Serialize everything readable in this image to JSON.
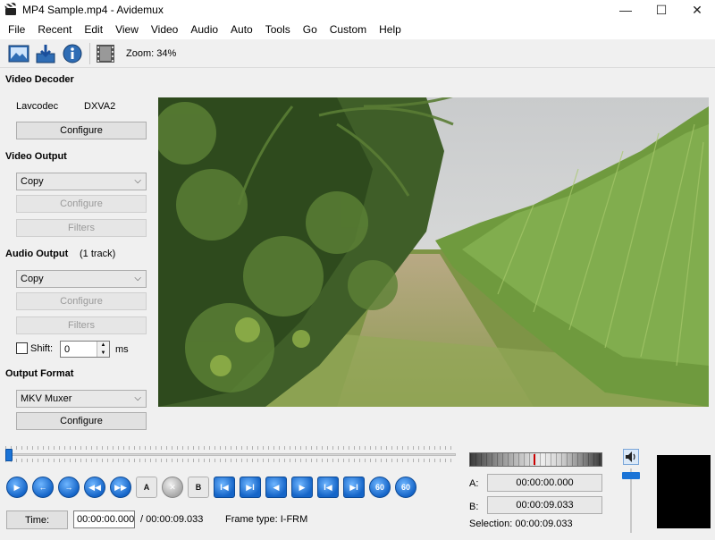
{
  "window": {
    "title": "MP4 Sample.mp4 - Avidemux",
    "controls": {
      "minimize": "—",
      "maximize": "☐",
      "close": "✕"
    }
  },
  "menu": [
    "File",
    "Recent",
    "Edit",
    "View",
    "Video",
    "Audio",
    "Auto",
    "Tools",
    "Go",
    "Custom",
    "Help"
  ],
  "toolbar": {
    "icons": [
      "open-video-icon",
      "save-video-icon",
      "info-icon",
      "film-strip-icon"
    ],
    "zoom_label": "Zoom: 34%"
  },
  "video_decoder": {
    "title": "Video Decoder",
    "codec": "Lavcodec",
    "hw": "DXVA2",
    "configure": "Configure"
  },
  "video_output": {
    "title": "Video Output",
    "selected": "Copy",
    "configure": "Configure",
    "filters": "Filters"
  },
  "audio_output": {
    "title": "Audio Output",
    "tracks": "(1 track)",
    "selected": "Copy",
    "configure": "Configure",
    "filters": "Filters",
    "shift_label": "Shift:",
    "shift_value": "0",
    "shift_unit": "ms"
  },
  "output_format": {
    "title": "Output Format",
    "selected": "MKV Muxer",
    "configure": "Configure"
  },
  "playback": {
    "scrub_position": 0,
    "controls": [
      {
        "name": "play-icon",
        "glyph": "▶"
      },
      {
        "name": "previous-frame-icon",
        "glyph": "←"
      },
      {
        "name": "next-frame-icon",
        "glyph": "→"
      },
      {
        "name": "previous-keyframe-icon",
        "glyph": "◀◀"
      },
      {
        "name": "next-keyframe-icon",
        "glyph": "▶▶"
      },
      {
        "name": "set-marker-a-icon",
        "glyph": "A"
      },
      {
        "name": "delete-icon",
        "glyph": "✕"
      },
      {
        "name": "set-marker-b-icon",
        "glyph": "B"
      },
      {
        "name": "go-marker-a-icon",
        "glyph": "I◀"
      },
      {
        "name": "go-marker-b-icon",
        "glyph": "▶I"
      },
      {
        "name": "previous-black-frame-icon",
        "glyph": "◀"
      },
      {
        "name": "next-black-frame-icon",
        "glyph": "▶"
      },
      {
        "name": "go-first-frame-icon",
        "glyph": "I◀"
      },
      {
        "name": "go-last-frame-icon",
        "glyph": "▶I"
      },
      {
        "name": "back-60s-icon",
        "glyph": "60"
      },
      {
        "name": "forward-60s-icon",
        "glyph": "60"
      }
    ],
    "time_button": "Time:",
    "current_time": "00:00:00.000",
    "total_time": "/ 00:00:09.033",
    "frame_type": "Frame type:  I-FRM"
  },
  "markers": {
    "a_label": "A:",
    "a_value": "00:00:00.000",
    "b_label": "B:",
    "b_value": "00:00:09.033",
    "selection": "Selection: 00:00:09.033"
  },
  "colors": {
    "accent": "#1a73d6"
  }
}
